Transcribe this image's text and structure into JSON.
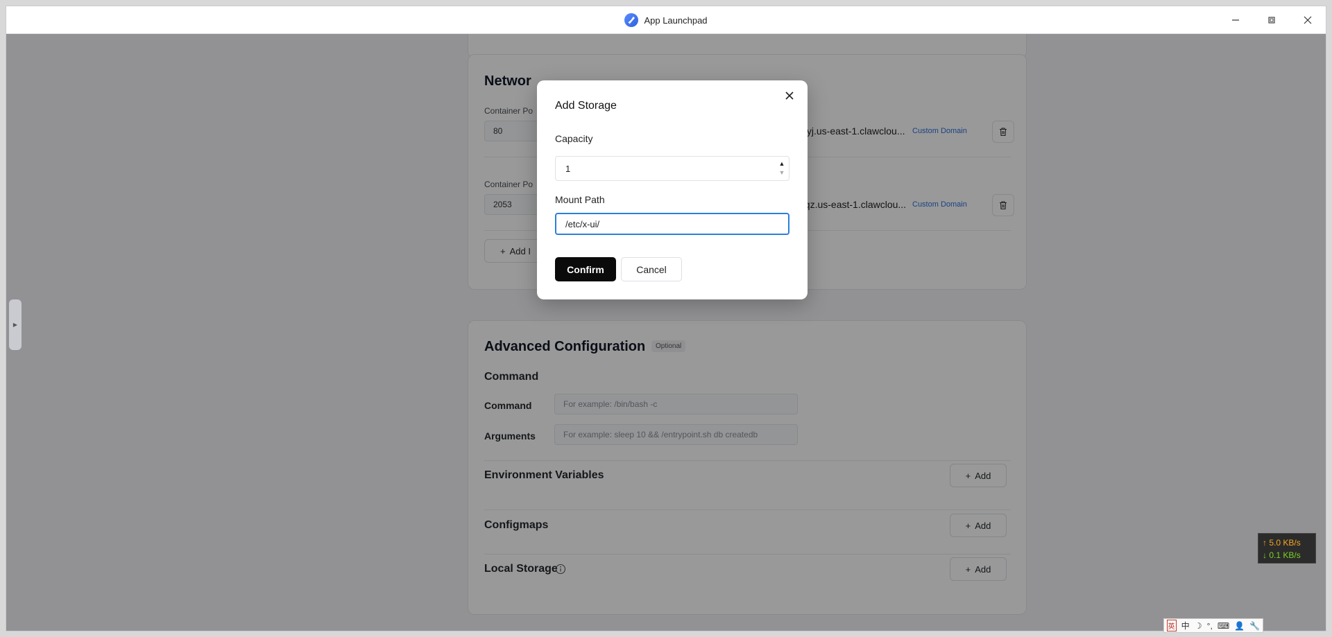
{
  "window": {
    "title": "App Launchpad",
    "controls": [
      "minimize",
      "restore",
      "close"
    ]
  },
  "network": {
    "title_partial": "Networ",
    "container_port_label": "Container Po",
    "ports": [
      {
        "port": "80",
        "domain": "blyj.us-east-1.clawclou...",
        "custom_domain_label": "Custom Domain"
      },
      {
        "port": "2053",
        "domain": "nqz.us-east-1.clawclou...",
        "custom_domain_label": "Custom Domain"
      }
    ],
    "add_button_partial": "Add I"
  },
  "advanced": {
    "title": "Advanced Configuration",
    "badge": "Optional",
    "command_section": "Command",
    "command_label": "Command",
    "command_placeholder": "For example:  /bin/bash -c",
    "arguments_label": "Arguments",
    "arguments_placeholder": "For example:  sleep 10 && /entrypoint.sh db createdb",
    "env_vars_label": "Environment Variables",
    "configmaps_label": "Configmaps",
    "local_storage_label": "Local Storage",
    "add_label": "Add"
  },
  "modal": {
    "title": "Add Storage",
    "capacity_label": "Capacity",
    "capacity_value": "1",
    "mount_path_label": "Mount Path",
    "mount_path_value": "/etc/x-ui/",
    "confirm_label": "Confirm",
    "cancel_label": "Cancel"
  },
  "tray": {
    "upload_speed": "↑ 5.0 KB/s",
    "download_speed": "↓ 0.1 KB/s",
    "ime_items": [
      "英",
      "中",
      "☽",
      "°,",
      "⌨",
      "👤",
      "🔧"
    ]
  },
  "colors": {
    "accent_blue": "#2b7fd9",
    "confirm_black": "#0b0b0b",
    "link_blue": "#2a6fdb"
  }
}
